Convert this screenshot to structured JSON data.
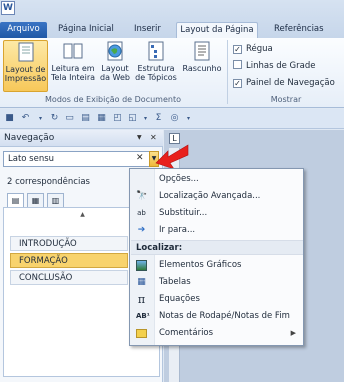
{
  "app_logo": "W",
  "tabs": [
    "Arquivo",
    "Página Inicial",
    "Inserir",
    "Layout da Página",
    "Referências"
  ],
  "ribbon": {
    "view_buttons": [
      {
        "line1": "Layout de",
        "line2": "Impressão",
        "icon": "print-layout-icon"
      },
      {
        "line1": "Leitura em",
        "line2": "Tela Inteira",
        "icon": "full-screen-reading-icon"
      },
      {
        "line1": "Layout",
        "line2": "da Web",
        "icon": "web-layout-icon"
      },
      {
        "line1": "Estrutura",
        "line2": "de Tópicos",
        "icon": "outline-icon"
      },
      {
        "line1": "Rascunho",
        "line2": "",
        "icon": "draft-icon"
      }
    ],
    "group1_label": "Modos de Exibição de Documento",
    "checks": [
      {
        "label": "Régua",
        "checked": true
      },
      {
        "label": "Linhas de Grade",
        "checked": false
      },
      {
        "label": "Painel de Navegação",
        "checked": true
      }
    ],
    "group2_label": "Mostrar"
  },
  "nav": {
    "title": "Navegação",
    "search_value": "Lato sensu",
    "count": "2 correspondências",
    "headings": [
      "INTRODUÇÃO",
      "FORMAÇÃO",
      "CONCLUSÃO"
    ]
  },
  "menu": {
    "items_top": [
      {
        "label": "Opções...",
        "icon": "options-icon"
      },
      {
        "label": "Localização Avançada...",
        "icon": "advanced-find-icon"
      },
      {
        "label": "Substituir...",
        "icon": "replace-icon"
      },
      {
        "label": "Ir para...",
        "icon": "goto-icon"
      }
    ],
    "section": "Localizar:",
    "items_bottom": [
      {
        "label": "Elementos Gráficos",
        "icon": "graphics-icon"
      },
      {
        "label": "Tabelas",
        "icon": "tables-icon"
      },
      {
        "label": "Equações",
        "icon": "equations-icon"
      },
      {
        "label": "Notas de Rodapé/Notas de Fim",
        "icon": "footnotes-icon"
      },
      {
        "label": "Comentários",
        "icon": "comments-icon"
      }
    ]
  },
  "colors": {
    "accent": "#2b579a",
    "highlight": "#f8d36d",
    "arrow": "#e8201c"
  }
}
